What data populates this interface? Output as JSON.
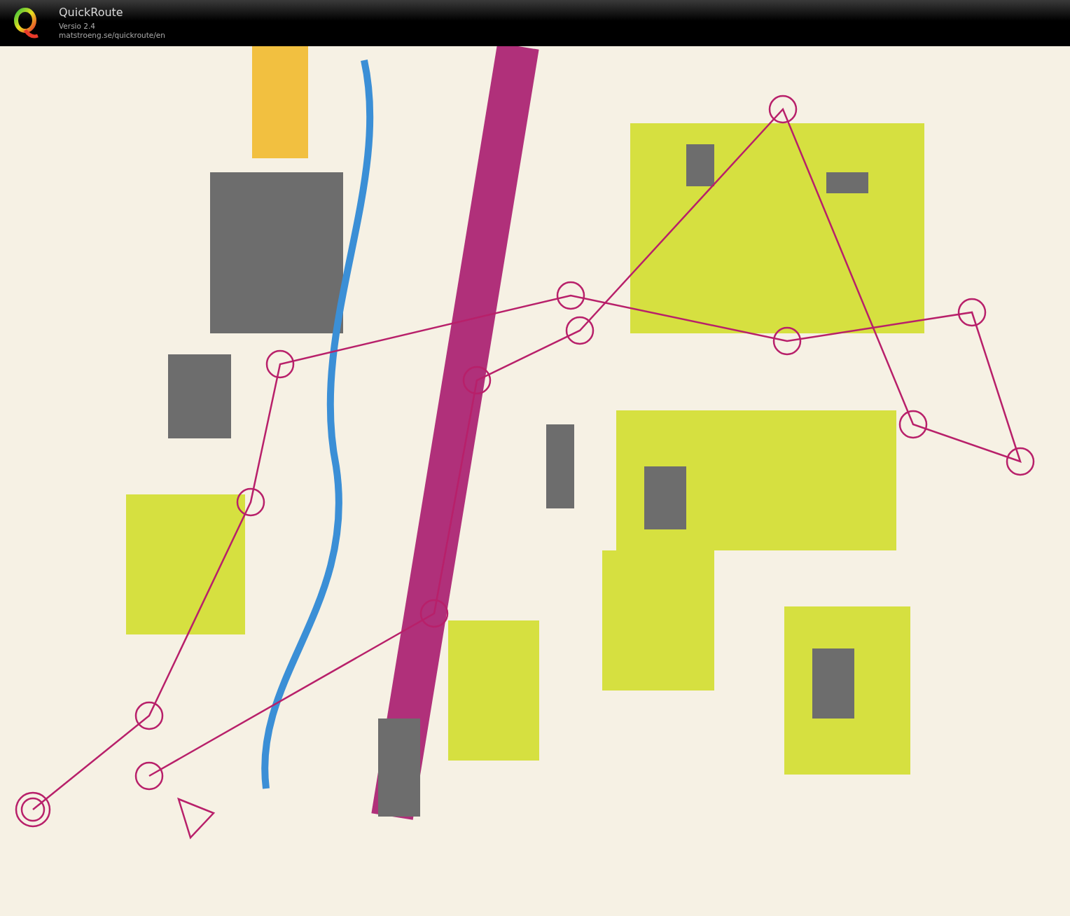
{
  "header": {
    "title": "QuickRoute",
    "version": "Versio 2.4",
    "url": "matstroeng.se/quickroute/en"
  }
}
